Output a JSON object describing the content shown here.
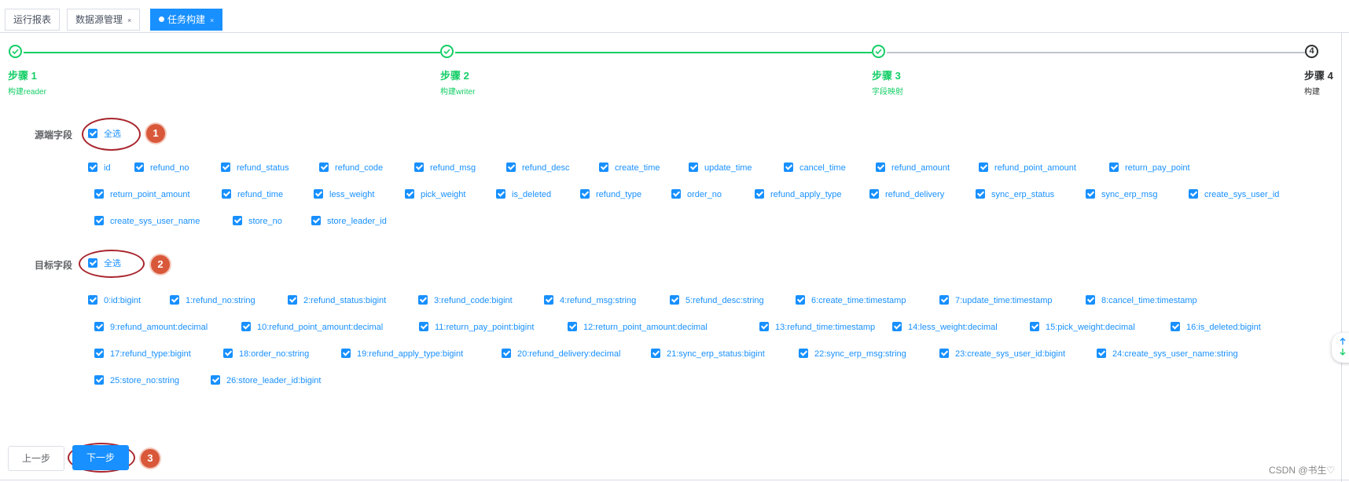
{
  "tabs": [
    {
      "label": "运行报表",
      "active": false,
      "closable": false
    },
    {
      "label": "数据源管理",
      "active": false,
      "closable": true
    },
    {
      "label": "任务构建",
      "active": true,
      "closable": true
    }
  ],
  "tab_close_glyph": "×",
  "steps": [
    {
      "number": "1",
      "title": "步骤 1",
      "desc": "构建reader",
      "status": "done"
    },
    {
      "number": "2",
      "title": "步骤 2",
      "desc": "构建writer",
      "status": "done"
    },
    {
      "number": "3",
      "title": "步骤 3",
      "desc": "字段映射",
      "status": "done"
    },
    {
      "number": "4",
      "title": "步骤 4",
      "desc": "构建",
      "status": "pending"
    }
  ],
  "colors": {
    "accent": "#1890ff",
    "success": "#13ce66",
    "callout": "#d9583a"
  },
  "source": {
    "label": "源端字段",
    "select_all": "全选",
    "select_all_checked": true,
    "callout": "1",
    "fields": [
      "id",
      "refund_no",
      "refund_status",
      "refund_code",
      "refund_msg",
      "refund_desc",
      "create_time",
      "update_time",
      "cancel_time",
      "refund_amount",
      "refund_point_amount",
      "return_pay_point",
      "return_point_amount",
      "refund_time",
      "less_weight",
      "pick_weight",
      "is_deleted",
      "refund_type",
      "order_no",
      "refund_apply_type",
      "refund_delivery",
      "sync_erp_status",
      "sync_erp_msg",
      "create_sys_user_id",
      "create_sys_user_name",
      "store_no",
      "store_leader_id"
    ]
  },
  "target": {
    "label": "目标字段",
    "select_all": "全选",
    "select_all_checked": true,
    "callout": "2",
    "fields": [
      "0:id:bigint",
      "1:refund_no:string",
      "2:refund_status:bigint",
      "3:refund_code:bigint",
      "4:refund_msg:string",
      "5:refund_desc:string",
      "6:create_time:timestamp",
      "7:update_time:timestamp",
      "8:cancel_time:timestamp",
      "9:refund_amount:decimal",
      "10:refund_point_amount:decimal",
      "11:return_pay_point:bigint",
      "12:return_point_amount:decimal",
      "13:refund_time:timestamp",
      "14:less_weight:decimal",
      "15:pick_weight:decimal",
      "16:is_deleted:bigint",
      "17:refund_type:bigint",
      "18:order_no:string",
      "19:refund_apply_type:bigint",
      "20:refund_delivery:decimal",
      "21:sync_erp_status:bigint",
      "22:sync_erp_msg:string",
      "23:create_sys_user_id:bigint",
      "24:create_sys_user_name:string",
      "25:store_no:string",
      "26:store_leader_id:bigint"
    ]
  },
  "buttons": {
    "prev": "上一步",
    "next": "下一步",
    "next_callout": "3"
  },
  "float_button_icons": [
    "arrow-up-icon",
    "arrow-down-icon"
  ],
  "watermark": "CSDN @书生♡"
}
